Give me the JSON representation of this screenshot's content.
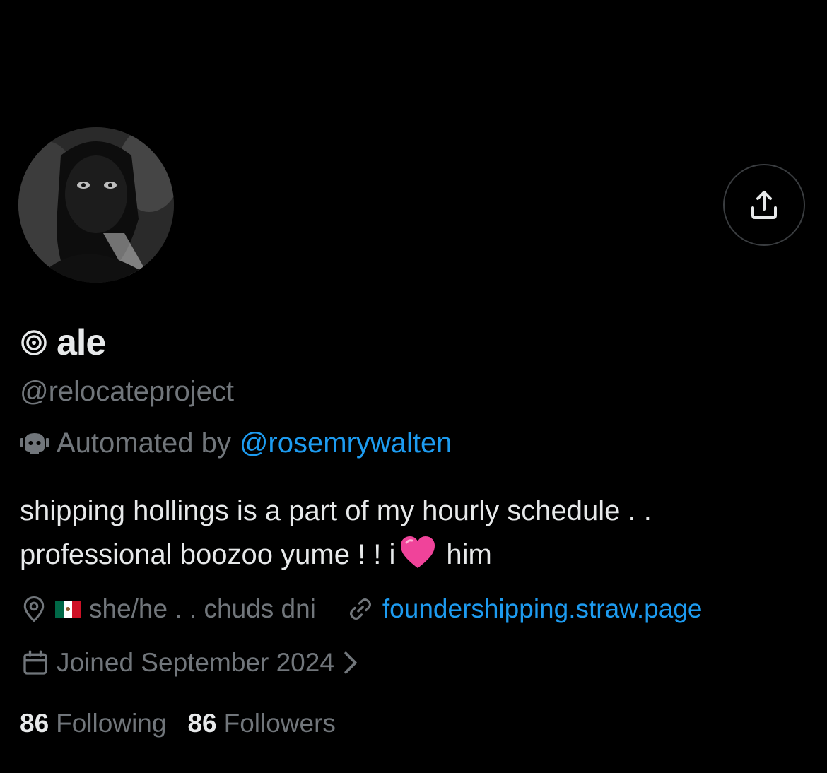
{
  "profile": {
    "display_name": "ale",
    "handle": "@relocateproject",
    "automated_prefix": "Automated by",
    "automated_by": "@rosemrywalten",
    "bio_line1": "shipping hollings is a part of my hourly schedule . .",
    "bio_line2_before": "professional boozoo yume ! ! i",
    "bio_line2_after": "him",
    "location": "she/he . . chuds dni",
    "website": "foundershipping.straw.page",
    "joined": "Joined September 2024",
    "following_count": "86",
    "following_label": "Following",
    "followers_count": "86",
    "followers_label": "Followers"
  },
  "icons": {
    "share": "share-icon",
    "spiral": "spiral-icon",
    "bot": "bot-icon",
    "heart": "pink-heart-emoji",
    "location": "location-pin-icon",
    "flag": "mexico-flag-emoji",
    "link": "link-icon",
    "calendar": "calendar-icon",
    "chevron": "chevron-right-icon"
  },
  "colors": {
    "background": "#000000",
    "text_primary": "#e7e9ea",
    "text_secondary": "#71767b",
    "link": "#1d9bf0",
    "heart": "#f0439a"
  }
}
